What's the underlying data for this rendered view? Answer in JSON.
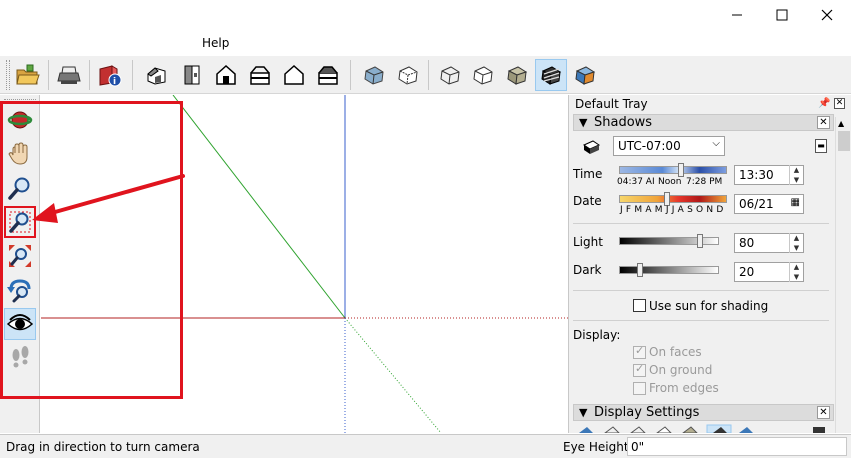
{
  "menu": {
    "help": "Help"
  },
  "tray": {
    "title": "Default Tray",
    "shadows": {
      "title": "Shadows",
      "timezone": "UTC-07:00",
      "time_label": "Time",
      "time_sunrise": "04:37 AI",
      "time_noon": "Noon",
      "time_sunset": "7:28 PM",
      "time_value": "13:30",
      "date_label": "Date",
      "months": "J F M A M J J A S O N D",
      "date_value": "06/21",
      "light_label": "Light",
      "light_value": "80",
      "dark_label": "Dark",
      "dark_value": "20",
      "use_sun": "Use sun for shading",
      "display_label": "Display:",
      "on_faces": "On faces",
      "on_ground": "On ground",
      "from_edges": "From edges"
    },
    "display_settings": {
      "title": "Display Settings"
    }
  },
  "status": {
    "message": "Drag in direction to turn camera",
    "eye_height_label": "Eye Height",
    "eye_height_value": "0\""
  },
  "colors": {
    "annotation": "#e0141e",
    "selection": "#cce4f7",
    "axis_green": "#2fa32f",
    "axis_red": "#b32020",
    "axis_blue": "#3a5fcd"
  }
}
